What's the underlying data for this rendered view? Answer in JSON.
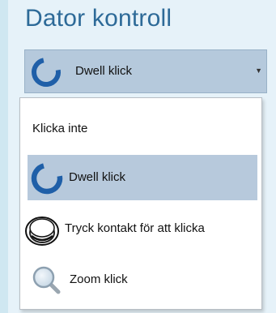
{
  "title": "Dator kontroll",
  "combo": {
    "selected_label": "Dwell klick",
    "selected_icon": "dwell-ring-icon",
    "arrow_icon": "chevron-down-icon"
  },
  "options": [
    {
      "label": "Klicka inte",
      "icon": null,
      "selected": false
    },
    {
      "label": "Dwell klick",
      "icon": "dwell-ring-icon",
      "selected": true
    },
    {
      "label": "Tryck kontakt för att klicka",
      "icon": "switch-button-icon",
      "selected": false
    },
    {
      "label": "Zoom klick",
      "icon": "magnifier-icon",
      "selected": false
    }
  ],
  "colors": {
    "accent": "#1f5fa8",
    "title": "#2d6a98",
    "combo_bg": "#b5c9dc",
    "selected_bg": "#b7c9dc"
  }
}
